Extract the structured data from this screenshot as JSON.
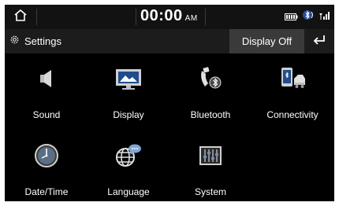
{
  "statusbar": {
    "time": "00:00",
    "ampm": "AM",
    "icons": [
      "battery-icon",
      "bluetooth-phone-icon",
      "signal-icon"
    ]
  },
  "titlebar": {
    "title": "Settings",
    "display_off_label": "Display Off",
    "back_icon": "back-arrow-icon"
  },
  "grid": {
    "items": [
      {
        "label": "Sound",
        "icon": "speaker-icon"
      },
      {
        "label": "Display",
        "icon": "monitor-icon"
      },
      {
        "label": "Bluetooth",
        "icon": "bluetooth-phone-icon"
      },
      {
        "label": "Connectivity",
        "icon": "connectivity-icon"
      },
      {
        "label": "Date/Time",
        "icon": "clock-icon"
      },
      {
        "label": "Language",
        "icon": "globe-icon"
      },
      {
        "label": "System",
        "icon": "equalizer-icon"
      }
    ]
  },
  "colors": {
    "background": "#000000",
    "statusbar": "#121212",
    "titlebar": "#1c1c1c",
    "button": "#3a3a3a",
    "text": "#ffffff"
  }
}
